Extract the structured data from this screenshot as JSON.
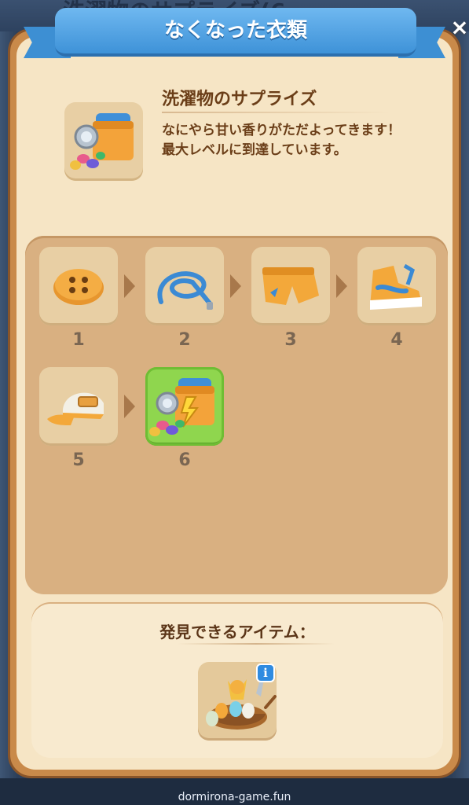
{
  "window": {
    "title": "なくなった衣類",
    "close_label": "×",
    "background_text": "洗濯物のサプライズ(6"
  },
  "header": {
    "item_icon": "washing-machine-icon",
    "item_name": "洗濯物のサプライズ",
    "description": "なにやら甘い香りがただよってきます！",
    "status": "最大レベルに到達しています。"
  },
  "merge_chain": {
    "items": [
      {
        "level": "1",
        "icon": "button-icon",
        "active": false
      },
      {
        "level": "2",
        "icon": "shoelace-icon",
        "active": false
      },
      {
        "level": "3",
        "icon": "shorts-icon",
        "active": false
      },
      {
        "level": "4",
        "icon": "sneaker-icon",
        "active": false
      },
      {
        "level": "5",
        "icon": "cap-icon",
        "active": false
      },
      {
        "level": "6",
        "icon": "washing-machine-icon",
        "active": true
      }
    ]
  },
  "discover": {
    "title": "発見できるアイテム：",
    "item_icon": "easter-basket-icon",
    "info_label": "i"
  },
  "colors": {
    "ribbon": "#4a9ae0",
    "panel_frame": "#c98a4a",
    "panel_bg": "#f6e5c5",
    "active_tile": "#8fd64e",
    "text_brown": "#6b3e18"
  },
  "watermark": "dormirona-game.fun"
}
